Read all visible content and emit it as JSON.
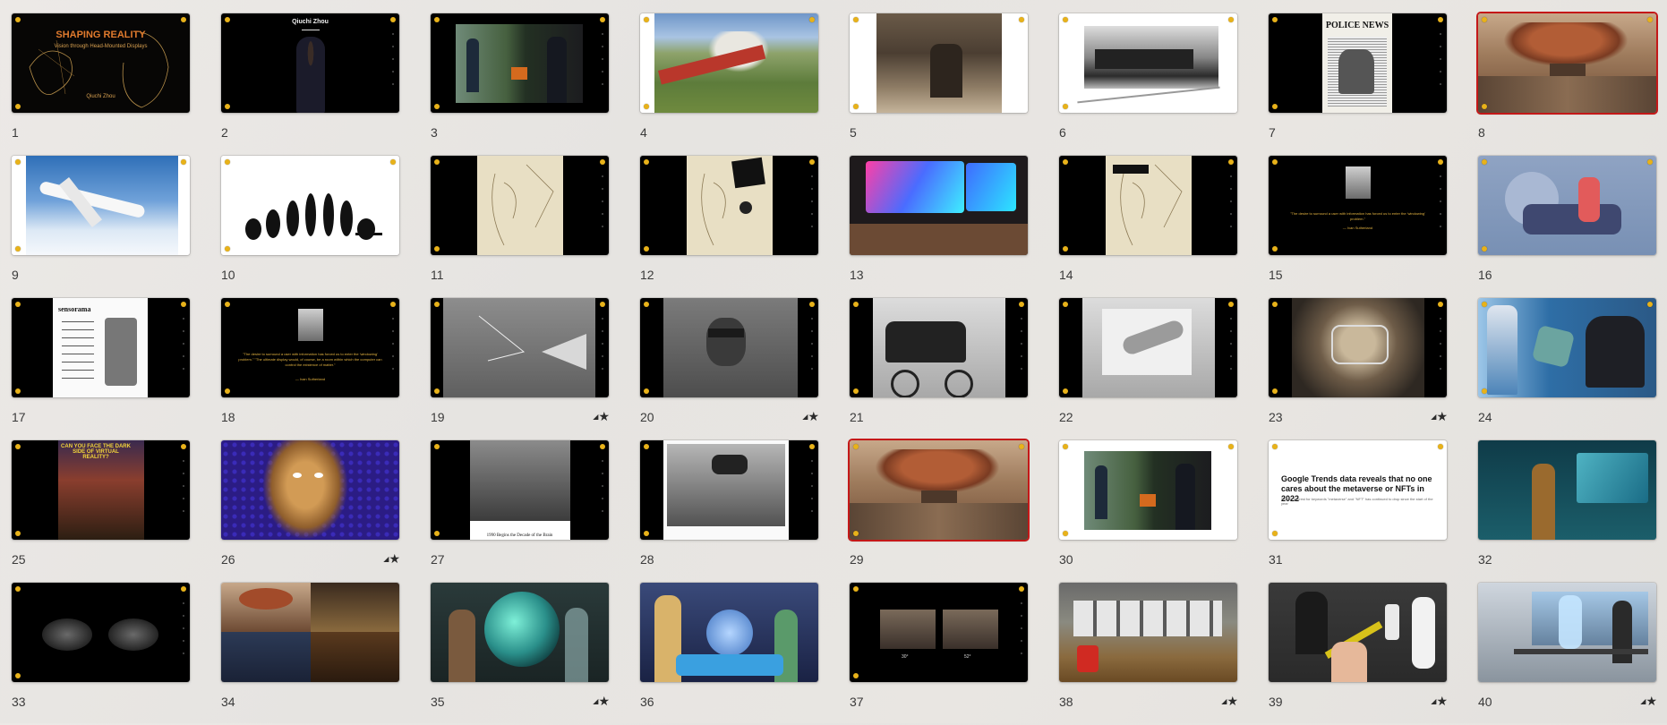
{
  "colors": {
    "selection": "#c41818",
    "slide_dot": "#e8b21a",
    "label": "#3a3a3a"
  },
  "slides": [
    {
      "number": "1",
      "starred": false,
      "selected": false,
      "title": "SHAPING REALITY",
      "subtitle": "Vision through Head-Mounted Displays",
      "author": "Qiuchi Zhou"
    },
    {
      "number": "2",
      "starred": false,
      "selected": false,
      "title": "Qiuchi Zhou"
    },
    {
      "number": "3",
      "starred": false,
      "selected": false
    },
    {
      "number": "4",
      "starred": false,
      "selected": false
    },
    {
      "number": "5",
      "starred": false,
      "selected": false
    },
    {
      "number": "6",
      "starred": false,
      "selected": false
    },
    {
      "number": "7",
      "starred": false,
      "selected": false,
      "title": "POLICE NEWS"
    },
    {
      "number": "8",
      "starred": false,
      "selected": true
    },
    {
      "number": "9",
      "starred": false,
      "selected": false
    },
    {
      "number": "10",
      "starred": false,
      "selected": false
    },
    {
      "number": "11",
      "starred": false,
      "selected": false
    },
    {
      "number": "12",
      "starred": false,
      "selected": false
    },
    {
      "number": "13",
      "starred": false,
      "selected": false
    },
    {
      "number": "14",
      "starred": false,
      "selected": false
    },
    {
      "number": "15",
      "starred": false,
      "selected": false,
      "quote": "\"The desire to surround a user with information has forced us to enter the 'windowing' problem.\"",
      "attribution": "— Ivan Sutherland"
    },
    {
      "number": "16",
      "starred": false,
      "selected": false
    },
    {
      "number": "17",
      "starred": false,
      "selected": false,
      "title": "sensorama"
    },
    {
      "number": "18",
      "starred": false,
      "selected": false,
      "quote": "\"The desire to surround a user with information has forced us to enter the 'windowing' problem.\" \"The ultimate display would, of course, be a room within which the computer can control the existence of matter.\"",
      "attribution": "— Ivan Sutherland"
    },
    {
      "number": "19",
      "starred": true,
      "selected": false
    },
    {
      "number": "20",
      "starred": true,
      "selected": false
    },
    {
      "number": "21",
      "starred": false,
      "selected": false
    },
    {
      "number": "22",
      "starred": false,
      "selected": false
    },
    {
      "number": "23",
      "starred": true,
      "selected": false
    },
    {
      "number": "24",
      "starred": false,
      "selected": false
    },
    {
      "number": "25",
      "starred": false,
      "selected": false,
      "title": "CAN YOU FACE THE DARK SIDE OF VIRTUAL REALITY?"
    },
    {
      "number": "26",
      "starred": true,
      "selected": false
    },
    {
      "number": "27",
      "starred": false,
      "selected": false,
      "caption": "1990 Begins the Decade of the Brain"
    },
    {
      "number": "28",
      "starred": false,
      "selected": false
    },
    {
      "number": "29",
      "starred": false,
      "selected": true
    },
    {
      "number": "30",
      "starred": false,
      "selected": false
    },
    {
      "number": "31",
      "starred": false,
      "selected": false,
      "title": "Google Trends data reveals that no one cares about the metaverse or NFTs in 2022",
      "subtitle": "Search interest for keywords \"metaverse\" and \"NFT\" has continued to drop since the start of the year"
    },
    {
      "number": "32",
      "starred": false,
      "selected": false
    },
    {
      "number": "33",
      "starred": false,
      "selected": false
    },
    {
      "number": "34",
      "starred": false,
      "selected": false
    },
    {
      "number": "35",
      "starred": true,
      "selected": false
    },
    {
      "number": "36",
      "starred": false,
      "selected": false
    },
    {
      "number": "37",
      "starred": false,
      "selected": false,
      "left_label": "30°",
      "right_label": "52°"
    },
    {
      "number": "38",
      "starred": true,
      "selected": false
    },
    {
      "number": "39",
      "starred": true,
      "selected": false
    },
    {
      "number": "40",
      "starred": true,
      "selected": false
    }
  ]
}
